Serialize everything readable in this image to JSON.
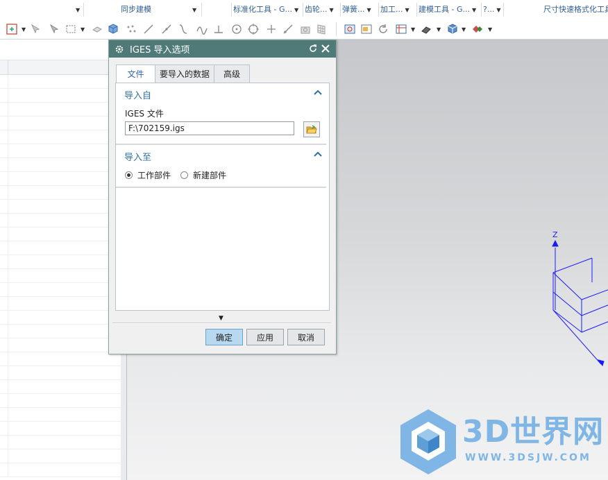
{
  "ribbon": {
    "groups": [
      {
        "label": "同步建模"
      },
      {
        "label": "标准化工具 - G..."
      },
      {
        "label": "齿轮..."
      },
      {
        "label": "弹簧..."
      },
      {
        "label": "加工..."
      },
      {
        "label": "建模工具 - G..."
      },
      {
        "label": "?..."
      },
      {
        "label": "尺寸快速格式化工具"
      }
    ]
  },
  "dialog": {
    "title": "IGES 导入选项",
    "tabs": [
      {
        "label": "文件",
        "active": true
      },
      {
        "label": "要导入的数据",
        "active": false
      },
      {
        "label": "高级",
        "active": false
      }
    ],
    "import_from": {
      "header": "导入自",
      "file_label": "IGES 文件",
      "file_value": "F:\\702159.igs"
    },
    "import_to": {
      "header": "导入至",
      "options": [
        {
          "label": "工作部件",
          "selected": true
        },
        {
          "label": "新建部件",
          "selected": false
        }
      ]
    },
    "buttons": {
      "ok": "确定",
      "apply": "应用",
      "cancel": "取消"
    }
  },
  "viewport": {
    "axis_label_z": "Z"
  },
  "watermark": {
    "title": "3D世界网",
    "url": "WWW.3DSJW.COM"
  },
  "colors": {
    "dialog_title_bar": "#4f7a77",
    "section_header": "#2e6fa3",
    "primary_button": "#b8d8ef",
    "axis_blue": "#1a1aff",
    "watermark": "#7fb6e6"
  }
}
